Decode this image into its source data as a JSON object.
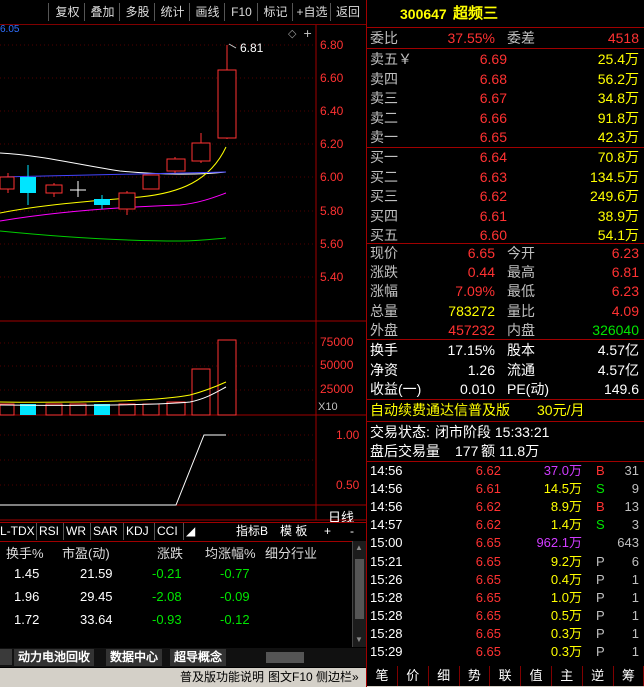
{
  "toolbar": {
    "buttons": [
      "复权",
      "叠加",
      "多股",
      "统计",
      "画线",
      "F10",
      "标记",
      "+自选",
      "返回"
    ]
  },
  "chart": {
    "top_left_value": "6.05",
    "max_label": "6.81",
    "price_ticks": [
      "6.80",
      "6.60",
      "6.40",
      "6.20",
      "6.00",
      "5.80",
      "5.60",
      "5.40"
    ],
    "volume_ticks": [
      "75000",
      "50000",
      "25000"
    ],
    "volume_unit": "X10",
    "indicator_ticks": [
      "1.00",
      "0.50"
    ],
    "day_label": "日线"
  },
  "indicator_tabs": [
    "L-TDX",
    "RSI",
    "WR",
    "SAR",
    "KDJ",
    "CCI"
  ],
  "indicator_right": {
    "tab_b": "指标B",
    "template": "模 板",
    "plus": "+",
    "minus": "-"
  },
  "table": {
    "headers": [
      "换手%",
      "市盈(动)",
      "涨跌",
      "均涨幅%",
      "细分行业"
    ],
    "rows": [
      {
        "turnover": "1.45",
        "pe": "21.59",
        "change": "-0.21",
        "avg": "-0.77"
      },
      {
        "turnover": "1.96",
        "pe": "29.45",
        "change": "-2.08",
        "avg": "-0.09"
      },
      {
        "turnover": "1.72",
        "pe": "33.64",
        "change": "-0.93",
        "avg": "-0.12"
      }
    ]
  },
  "bottom_tabs": [
    "动力电池回收",
    "数据中心",
    "超导概念"
  ],
  "status": {
    "left": "普及版功能说明",
    "mid": "图文F10",
    "right": "侧边栏»"
  },
  "stock": {
    "code": "300647",
    "name": "超频三"
  },
  "weibi": {
    "label": "委比",
    "value": "37.55%",
    "label2": "委差",
    "value2": "4518"
  },
  "sells": [
    {
      "label": "卖五￥",
      "price": "6.69",
      "vol": "25.4万"
    },
    {
      "label": "卖四",
      "price": "6.68",
      "vol": "56.2万"
    },
    {
      "label": "卖三",
      "price": "6.67",
      "vol": "34.8万"
    },
    {
      "label": "卖二",
      "price": "6.66",
      "vol": "91.8万"
    },
    {
      "label": "卖一",
      "price": "6.65",
      "vol": "42.3万"
    }
  ],
  "buys": [
    {
      "label": "买一",
      "price": "6.64",
      "vol": "70.8万"
    },
    {
      "label": "买二",
      "price": "6.63",
      "vol": "134.5万"
    },
    {
      "label": "买三",
      "price": "6.62",
      "vol": "249.6万"
    },
    {
      "label": "买四",
      "price": "6.61",
      "vol": "38.9万"
    },
    {
      "label": "买五",
      "price": "6.60",
      "vol": "54.1万"
    }
  ],
  "quote": [
    {
      "l1": "现价",
      "v1": "6.65",
      "l2": "今开",
      "v2": "6.23",
      "c1": "red",
      "c2": "red"
    },
    {
      "l1": "涨跌",
      "v1": "0.44",
      "l2": "最高",
      "v2": "6.81",
      "c1": "red",
      "c2": "red"
    },
    {
      "l1": "涨幅",
      "v1": "7.09%",
      "l2": "最低",
      "v2": "6.23",
      "c1": "red",
      "c2": "red"
    },
    {
      "l1": "总量",
      "v1": "783272",
      "l2": "量比",
      "v2": "4.09",
      "c1": "yellow",
      "c2": "red"
    },
    {
      "l1": "外盘",
      "v1": "457232",
      "l2": "内盘",
      "v2": "326040",
      "c1": "red",
      "c2": "green"
    }
  ],
  "fundamentals": [
    {
      "l1": "换手",
      "v1": "17.15%",
      "l2": "股本",
      "v2": "4.57亿"
    },
    {
      "l1": "净资",
      "v1": "1.26",
      "l2": "流通",
      "v2": "4.57亿"
    },
    {
      "l1": "收益(一)",
      "v1": "0.010",
      "l2": "PE(动)",
      "v2": "149.6"
    }
  ],
  "promo": {
    "text": "自动续费通达信普及版",
    "price": "30元/月"
  },
  "trade_state": {
    "label": "交易状态:",
    "value": "闭市阶段 15:33:21"
  },
  "after_hours": {
    "label": "盘后交易量",
    "vol": "177",
    "amt_label": "额",
    "amt": "11.8万"
  },
  "ticks": [
    {
      "time": "14:56",
      "price": "6.62",
      "vol": "37.0万",
      "side": "B",
      "n": "31",
      "vc": "purple",
      "sc": "red"
    },
    {
      "time": "14:56",
      "price": "6.61",
      "vol": "14.5万",
      "side": "S",
      "n": "9",
      "vc": "yellow",
      "sc": "green"
    },
    {
      "time": "14:56",
      "price": "6.62",
      "vol": "8.9万",
      "side": "B",
      "n": "13",
      "vc": "yellow",
      "sc": "red"
    },
    {
      "time": "14:57",
      "price": "6.62",
      "vol": "1.4万",
      "side": "S",
      "n": "3",
      "vc": "yellow",
      "sc": "green"
    },
    {
      "time": "15:00",
      "price": "6.65",
      "vol": "962.1万",
      "side": "",
      "n": "643",
      "vc": "purple",
      "sc": "gray"
    },
    {
      "time": "15:21",
      "price": "6.65",
      "vol": "9.2万",
      "side": "P",
      "n": "6",
      "vc": "yellow",
      "sc": "gray"
    },
    {
      "time": "15:26",
      "price": "6.65",
      "vol": "0.4万",
      "side": "P",
      "n": "1",
      "vc": "yellow",
      "sc": "gray"
    },
    {
      "time": "15:28",
      "price": "6.65",
      "vol": "1.0万",
      "side": "P",
      "n": "1",
      "vc": "yellow",
      "sc": "gray"
    },
    {
      "time": "15:28",
      "price": "6.65",
      "vol": "0.5万",
      "side": "P",
      "n": "1",
      "vc": "yellow",
      "sc": "gray"
    },
    {
      "time": "15:28",
      "price": "6.65",
      "vol": "0.3万",
      "side": "P",
      "n": "1",
      "vc": "yellow",
      "sc": "gray"
    },
    {
      "time": "15:29",
      "price": "6.65",
      "vol": "0.3万",
      "side": "P",
      "n": "1",
      "vc": "yellow",
      "sc": "gray"
    }
  ],
  "bottom_nav": [
    "笔",
    "价",
    "细",
    "势",
    "联",
    "值",
    "主",
    "逆",
    "筹"
  ]
}
